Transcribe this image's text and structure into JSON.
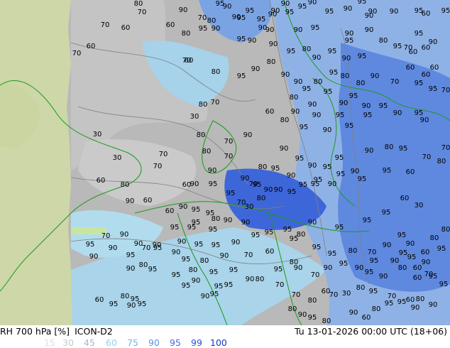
{
  "header": {
    "variable": "RH 700 hPa [%]",
    "model": "ICON-D2",
    "valid_time": "Tu 13-01-2026 00:00 UTC (18+06)"
  },
  "legend": [
    {
      "label": "15",
      "color": "#d9e1e8"
    },
    {
      "label": "30",
      "color": "#bfcbd6"
    },
    {
      "label": "45",
      "color": "#a9b8c6"
    },
    {
      "label": "60",
      "color": "#8fd2ec"
    },
    {
      "label": "75",
      "color": "#73b7e0"
    },
    {
      "label": "90",
      "color": "#5a93de"
    },
    {
      "label": "95",
      "color": "#3f6fe0"
    },
    {
      "label": "99",
      "color": "#2a4fd8"
    },
    {
      "label": "100",
      "color": "#1533c8"
    }
  ],
  "map_colors": {
    "land_outside": "#cdd7a8",
    "low": "#b2b2b2",
    "mid_low": "#c9c9c9",
    "mid": "#a8d6ee",
    "high": "#8fb3e8",
    "very_high": "#5a86e0",
    "saturated": "#3a63d8",
    "contour": "#808080",
    "coast": "#1a9a1a"
  },
  "contour_labels": [
    "80",
    "70",
    "90",
    "95",
    "90",
    "95",
    "90",
    "90",
    "95",
    "90",
    "95",
    "90",
    "95",
    "90",
    "90",
    "95",
    "95",
    "90",
    "95",
    "70",
    "60",
    "60",
    "70",
    "80",
    "95",
    "90",
    "90",
    "95",
    "90",
    "60",
    "60",
    "70",
    "80",
    "95",
    "90",
    "90",
    "90",
    "95",
    "90",
    "70",
    "60",
    "95",
    "90",
    "90",
    "95",
    "80",
    "90",
    "95",
    "90",
    "95",
    "80",
    "95",
    "70",
    "60",
    "60",
    "90",
    "95",
    "90",
    "95",
    "80",
    "95",
    "90",
    "80",
    "90",
    "90",
    "95",
    "80",
    "95",
    "80",
    "80",
    "90",
    "70",
    "60",
    "95",
    "95",
    "70",
    "60",
    "60",
    "95",
    "90",
    "95",
    "90",
    "95",
    "90",
    "95",
    "30",
    "80",
    "70",
    "30",
    "80",
    "90",
    "70",
    "60",
    "80",
    "95",
    "90",
    "95",
    "90",
    "90",
    "80",
    "90",
    "95",
    "95",
    "90",
    "30",
    "70",
    "80",
    "70",
    "80",
    "90",
    "95",
    "90",
    "95",
    "95",
    "90",
    "80",
    "95",
    "70",
    "70",
    "60",
    "80",
    "70",
    "60",
    "90",
    "95",
    "90",
    "95",
    "95",
    "90",
    "95",
    "95",
    "90",
    "95",
    "60",
    "80",
    "90",
    "95",
    "70",
    "80",
    "90",
    "90",
    "95",
    "95",
    "95",
    "90",
    "95",
    "95",
    "60",
    "30",
    "60",
    "90",
    "60",
    "90",
    "95",
    "95",
    "95",
    "80",
    "90",
    "70",
    "30",
    "70",
    "90",
    "95",
    "95",
    "95",
    "90",
    "95",
    "95",
    "90",
    "95",
    "95",
    "95",
    "90",
    "60",
    "80",
    "80",
    "90",
    "95",
    "90",
    "95",
    "95",
    "90",
    "95",
    "95",
    "80",
    "95",
    "95",
    "80",
    "70",
    "90",
    "95",
    "95",
    "90",
    "95",
    "95",
    "90",
    "90",
    "95",
    "70",
    "90",
    "90",
    "95",
    "80",
    "90",
    "70",
    "60",
    "80",
    "70",
    "90",
    "95",
    "90",
    "95",
    "90",
    "60",
    "70",
    "90",
    "80",
    "95",
    "95",
    "80",
    "95",
    "95",
    "90",
    "95",
    "90",
    "95",
    "90",
    "80",
    "60",
    "95",
    "95",
    "80",
    "95",
    "95",
    "90",
    "95",
    "95",
    "80",
    "70",
    "60",
    "30",
    "80",
    "95",
    "70",
    "60",
    "80",
    "90",
    "60",
    "95",
    "90",
    "95",
    "90",
    "95",
    "70",
    "80",
    "70",
    "90",
    "60",
    "80",
    "95",
    "95",
    "90",
    "80",
    "90",
    "95",
    "80"
  ]
}
